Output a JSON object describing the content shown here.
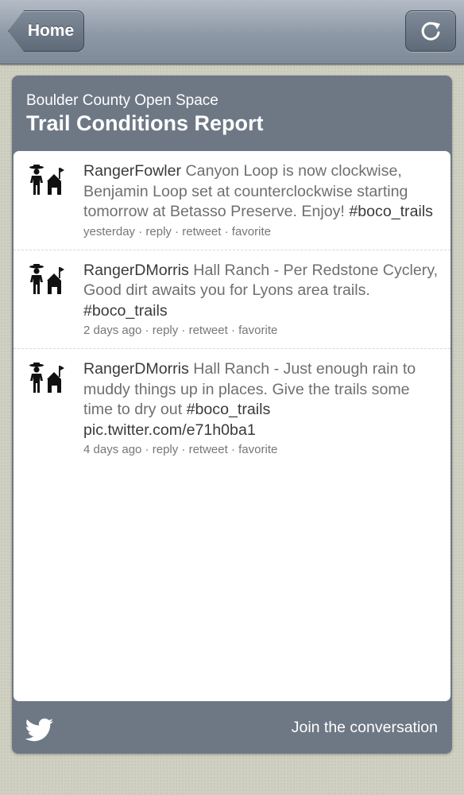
{
  "navbar": {
    "home_label": "Home",
    "refresh_icon": "refresh-icon"
  },
  "panel": {
    "subtitle": "Boulder County Open Space",
    "title": "Trail Conditions Report"
  },
  "tweets": [
    {
      "author": "RangerFowler",
      "text": "Canyon Loop is now clockwise, Benjamin Loop set at counterclockwise starting tomorrow at Betasso Preserve. Enjoy!",
      "hashtag": "#boco_trails",
      "link": "",
      "time": "yesterday",
      "reply": "reply",
      "retweet": "retweet",
      "favorite": "favorite"
    },
    {
      "author": "RangerDMorris",
      "text": "Hall Ranch - Per Redstone Cyclery, Good dirt awaits you for Lyons area trails.",
      "hashtag": "#boco_trails",
      "link": "",
      "time": "2 days ago",
      "reply": "reply",
      "retweet": "retweet",
      "favorite": "favorite"
    },
    {
      "author": "RangerDMorris",
      "text": "Hall Ranch - Just enough rain to muddy things up in places. Give the trails some time to dry out",
      "hashtag": "#boco_trails",
      "link": "pic.twitter.com/e71h0ba1",
      "time": "4 days ago",
      "reply": "reply",
      "retweet": "retweet",
      "favorite": "favorite"
    }
  ],
  "footer": {
    "twitter_icon": "twitter-bird-icon",
    "join_label": "Join the conversation"
  },
  "colors": {
    "navbar": "#8d98a6",
    "panel": "#6e7885",
    "background": "#cfd0c1"
  }
}
